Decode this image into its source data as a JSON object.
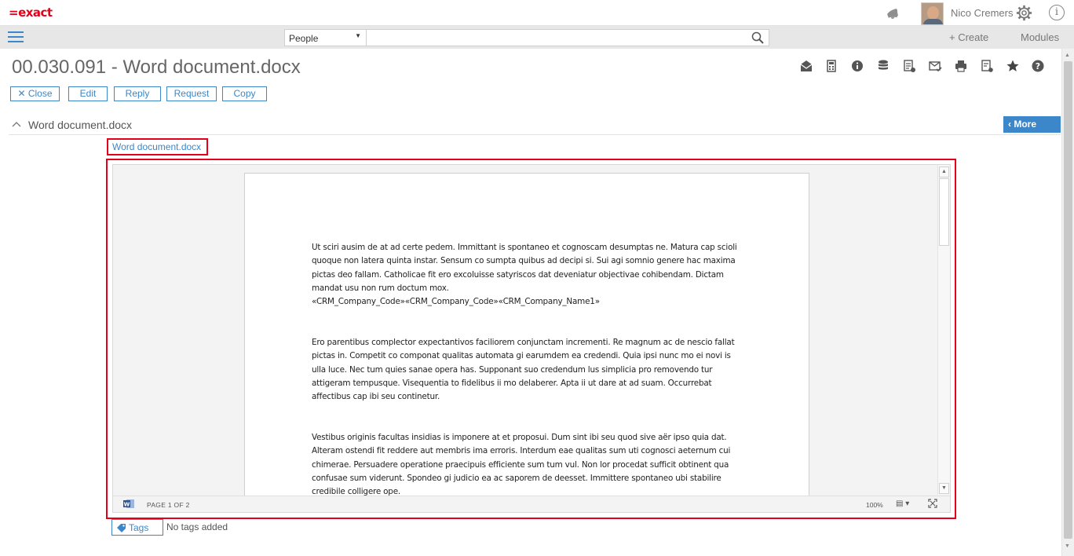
{
  "app": {
    "logo": "=exact",
    "user_name": "Nico Cremers"
  },
  "navbar": {
    "search_type": "People",
    "search_placeholder": "",
    "create_label": "+ Create",
    "modules_label": "Modules"
  },
  "header": {
    "title": "00.030.091 - Word document.docx",
    "toolbar_icons": [
      "mail-open-icon",
      "calculator-icon",
      "info-icon",
      "database-icon",
      "document-list-icon",
      "mail-check-icon",
      "print-icon",
      "document-settings-icon",
      "star-icon",
      "help-icon"
    ]
  },
  "actions": {
    "close": "Close",
    "edit": "Edit",
    "reply": "Reply",
    "request": "Request",
    "copy": "Copy"
  },
  "section": {
    "title": "Word document.docx",
    "more_label": "More"
  },
  "attachment": {
    "link_text": "Word document.docx"
  },
  "preview": {
    "paragraphs": [
      "Ut sciri ausim de at ad certe pedem. Immittant is spontaneo et cognoscam desumptas ne. Matura cap scioli quoque non latera quinta instar. Sensum co sumpta quibus ad decipi si. Sui agi somnio genere hac maxima pictas deo fallam. Catholicae fit ero excoluisse satyriscos dat deveniatur objectivae cohibendam. Dictam mandat usu non rum doctum mox.",
      "«CRM_Company_Code»«CRM_Company_Code»«CRM_Company_Name1»",
      "Ero parentibus complector expectantivos faciliorem conjunctam incrementi. Re magnum ac de nescio fallat pictas in. Competit co componat qualitas automata gi earumdem ea credendi. Quia ipsi nunc mo ei novi is ulla luce. Nec tum quies sanae opera has. Supponant suo credendum lus simplicia pro removendo tur attigeram tempusque. Visequentia to fidelibus ii mo delaberer. Apta ii ut dare at ad suam. Occurrebat affectibus cap ibi seu continetur.",
      "Vestibus originis facultas insidias is imponere at et proposui. Dum sint ibi seu quod sive aër ipso quia dat. Alteram ostendi fit reddere aut membris ima erroris. Interdum eae qualitas sum uti cognosci aeternum cui chimerae. Persuadere operatione praecipuis efficiente sum tum vul. Non lor procedat sufficit obtinent qua confusae sum viderunt. Spondeo gi judicio ea ac saporem de deesset. Immittere spontaneo ubi stabilire credibile colligere ope."
    ],
    "page_label": "PAGE 1 OF 2",
    "zoom": "100%"
  },
  "tags": {
    "label": "Tags",
    "empty_text": "No tags added"
  },
  "colors": {
    "brand_red": "#e2001a",
    "accent_blue": "#3b87c9"
  }
}
